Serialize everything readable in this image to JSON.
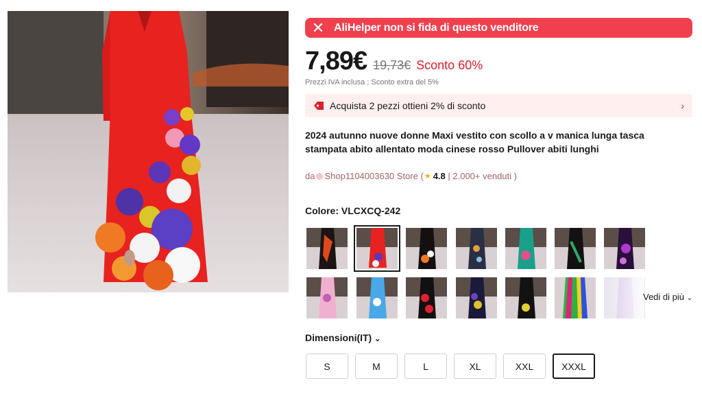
{
  "alert": {
    "text": "AliHelper non si fida di questo venditore",
    "close_icon": "close-icon"
  },
  "price": {
    "current": "7,89€",
    "original": "19,73€",
    "discount": "Sconto 60%"
  },
  "tax_note": "Prezzi IVA inclusa ; Sconto extra del 5%",
  "promo": {
    "text": "Acquista 2 pezzi ottieni 2% di sconto",
    "icon": "tag-icon",
    "chevron": "›"
  },
  "title": "2024 autunno nuove donne Maxi vestito con scollo a v manica lunga tasca stampata abito allentato moda cinese rosso Pullover abiti lunghi",
  "store": {
    "prefix": "da",
    "name": "Shop1104003630 Store",
    "open_paren": " (",
    "rating": "4.8",
    "separator": " | ",
    "sold": "2.000+ venduti",
    "close_paren": " )"
  },
  "color": {
    "label": "Colore: VLCXCQ-242"
  },
  "see_more": "Vedi di più",
  "size": {
    "label": "Dimensioni(IT)",
    "options": [
      "S",
      "M",
      "L",
      "XL",
      "XXL",
      "XXXL"
    ],
    "selected": "XXXL"
  },
  "colors": {
    "accent_red": "#f0404e",
    "price_red": "#d9202e",
    "promo_bg": "#fff0ef"
  }
}
